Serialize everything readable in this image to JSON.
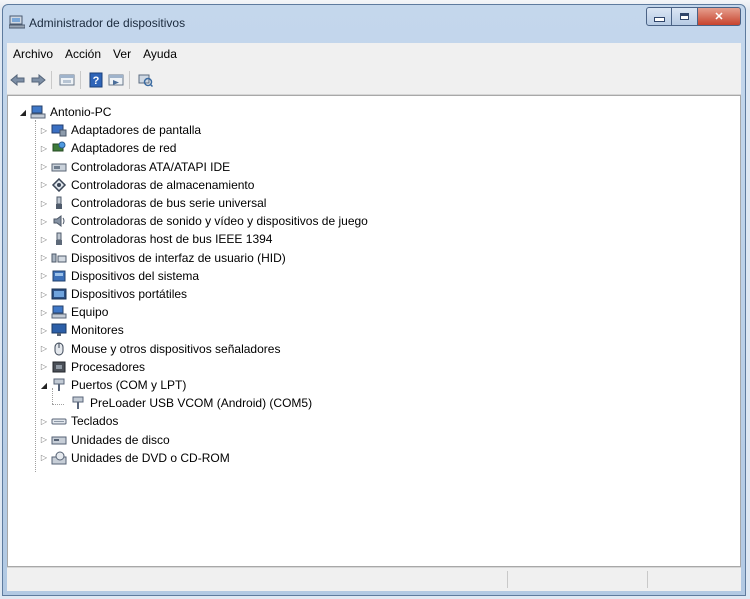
{
  "window": {
    "title": "Administrador de dispositivos"
  },
  "menu": [
    "Archivo",
    "Acción",
    "Ver",
    "Ayuda"
  ],
  "toolbar": [
    "back-icon",
    "forward-icon",
    "properties-icon",
    "help-icon",
    "update-driver-icon",
    "scan-hardware-icon"
  ],
  "tree": {
    "root": "Antonio-PC",
    "categories": [
      {
        "label": "Adaptadores de pantalla",
        "icon": "display-adapter-icon"
      },
      {
        "label": "Adaptadores de red",
        "icon": "network-adapter-icon"
      },
      {
        "label": "Controladoras ATA/ATAPI IDE",
        "icon": "ide-controller-icon"
      },
      {
        "label": "Controladoras de almacenamiento",
        "icon": "storage-controller-icon"
      },
      {
        "label": "Controladoras de bus serie universal",
        "icon": "usb-controller-icon"
      },
      {
        "label": "Controladoras de sonido y vídeo y dispositivos de juego",
        "icon": "sound-icon"
      },
      {
        "label": "Controladoras host de bus IEEE 1394",
        "icon": "firewire-icon"
      },
      {
        "label": "Dispositivos de interfaz de usuario (HID)",
        "icon": "hid-icon"
      },
      {
        "label": "Dispositivos del sistema",
        "icon": "system-device-icon"
      },
      {
        "label": "Dispositivos portátiles",
        "icon": "portable-device-icon"
      },
      {
        "label": "Equipo",
        "icon": "computer-icon"
      },
      {
        "label": "Monitores",
        "icon": "monitor-icon"
      },
      {
        "label": "Mouse y otros dispositivos señaladores",
        "icon": "mouse-icon"
      },
      {
        "label": "Procesadores",
        "icon": "processor-icon"
      },
      {
        "label": "Puertos (COM y LPT)",
        "icon": "port-icon",
        "expanded": true,
        "children": [
          {
            "label": "PreLoader USB VCOM (Android) (COM5)",
            "icon": "port-icon"
          }
        ]
      },
      {
        "label": "Teclados",
        "icon": "keyboard-icon"
      },
      {
        "label": "Unidades de disco",
        "icon": "disk-drive-icon"
      },
      {
        "label": "Unidades de DVD o CD-ROM",
        "icon": "dvd-drive-icon"
      }
    ]
  },
  "colors": {
    "titlebar": "#c4d7ec",
    "client_bg": "#ffffff",
    "close_button": "#c7432d"
  }
}
